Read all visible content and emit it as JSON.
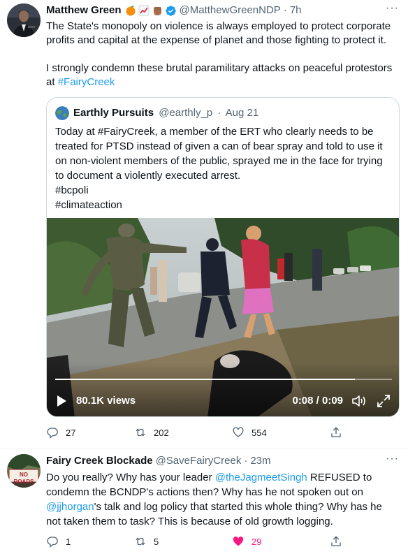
{
  "tweet1": {
    "name": "Matthew Green",
    "handle": "@MatthewGreenNDP",
    "time": "7h",
    "emojis": [
      "orange-emoji",
      "chart-increasing-emoji",
      "raised-fist-emoji"
    ],
    "text_p1": "The State's monopoly on violence is always employed to protect corporate profits and capital at the expense of planet and those fighting to protect it.",
    "text_p2_prefix": "I strongly condemn these brutal paramilitary attacks on peaceful protestors at ",
    "text_p2_hashtag": "#FairyCreek",
    "quote": {
      "name": "Earthly Pursuits",
      "handle": "@earthly_p",
      "date": "Aug 21",
      "text_lines": [
        "Today at #FairyCreek, a member of the ERT who clearly needs to be",
        "treated for PTSD instead of given a can of bear spray and told to use it",
        "on non-violent members of the public, sprayed me in the face for trying",
        "to document a violently executed arrest.",
        "#bcpoli",
        "#climateaction"
      ],
      "video": {
        "views": "80.1K views",
        "time": "0:08 / 0:09",
        "progress": 0.89
      }
    },
    "actions": {
      "replies": "27",
      "retweets": "202",
      "likes": "554"
    }
  },
  "tweet2": {
    "name": "Fairy Creek Blockade",
    "handle": "@SaveFairyCreek",
    "time": "23m",
    "avatar_sign": "NO ROADS",
    "line1_prefix": "Do you really? Why has your leader ",
    "line1_mention": "@theJagmeetSingh",
    "line1_suffix": " REFUSED to",
    "line2": "condemn the BCNDP's actions then? Why has he not spoken out on",
    "line3_mention": "@jjhorgan",
    "line3_suffix": "'s talk and log policy that started this whole thing? Why has he",
    "line4": "not taken them to task? This is because of old growth logging.",
    "actions": {
      "replies": "1",
      "retweets": "5",
      "likes": "29"
    },
    "liked_color": "#f91880"
  },
  "colors": {
    "accent": "#1d9bf0",
    "muted": "#536471",
    "verified": "#1d9bf0"
  }
}
